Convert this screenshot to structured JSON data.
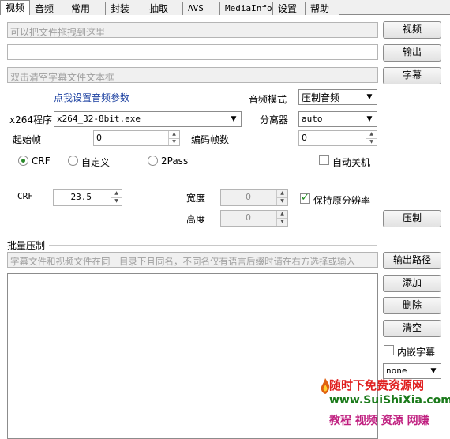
{
  "tabs": [
    "视频",
    "音频",
    "常用",
    "封装",
    "抽取",
    "AVS",
    "MediaInfo",
    "设置",
    "帮助"
  ],
  "top": {
    "video_placeholder": "可以把文件拖拽到这里",
    "output_value": "",
    "subtitle_placeholder": "双击清空字幕文件文本框",
    "video_button": "视频",
    "output_button": "输出",
    "subtitle_button": "字幕"
  },
  "audio": {
    "settings_link": "点我设置音频参数",
    "mode_label": "音频模式",
    "mode_value": "压制音频"
  },
  "encoder": {
    "x264_label": "x264程序",
    "x264_value": "x264_32-8bit.exe",
    "demux_label": "分离器",
    "demux_value": "auto",
    "start_frame_label": "起始帧",
    "start_frame_value": "0",
    "frame_count_label": "编码帧数",
    "frame_count_value": "0"
  },
  "rate_mode": {
    "crf_label": "CRF",
    "custom_label": "自定义",
    "twopass_label": "2Pass",
    "selected": "CRF",
    "shutdown_label": "自动关机",
    "shutdown_checked": false
  },
  "params": {
    "crf_label": "CRF",
    "crf_value": "23.5",
    "width_label": "宽度",
    "width_value": "0",
    "height_label": "高度",
    "height_value": "0",
    "keep_res_label": "保持原分辨率",
    "keep_res_checked": true,
    "encode_button": "压制"
  },
  "batch": {
    "title": "批量压制",
    "hint_placeholder": "字幕文件和视频文件在同一目录下且同名，不同名仅有语言后缀时请在右方选择或输入",
    "output_path_button": "输出路径",
    "add_button": "添加",
    "delete_button": "删除",
    "clear_button": "清空",
    "embed_sub_label": "内嵌字幕",
    "embed_sub_checked": false,
    "sub_lang_value": "none"
  },
  "watermark": {
    "line1": "随时下免费资源网",
    "line2": "www.SuiShiXia.com",
    "line3": "教程 视频 资源 网赚"
  },
  "colors": {
    "link": "#1a3fa0",
    "radio_selected": "#2a8a2a",
    "checkmark": "#1a8a1a"
  }
}
